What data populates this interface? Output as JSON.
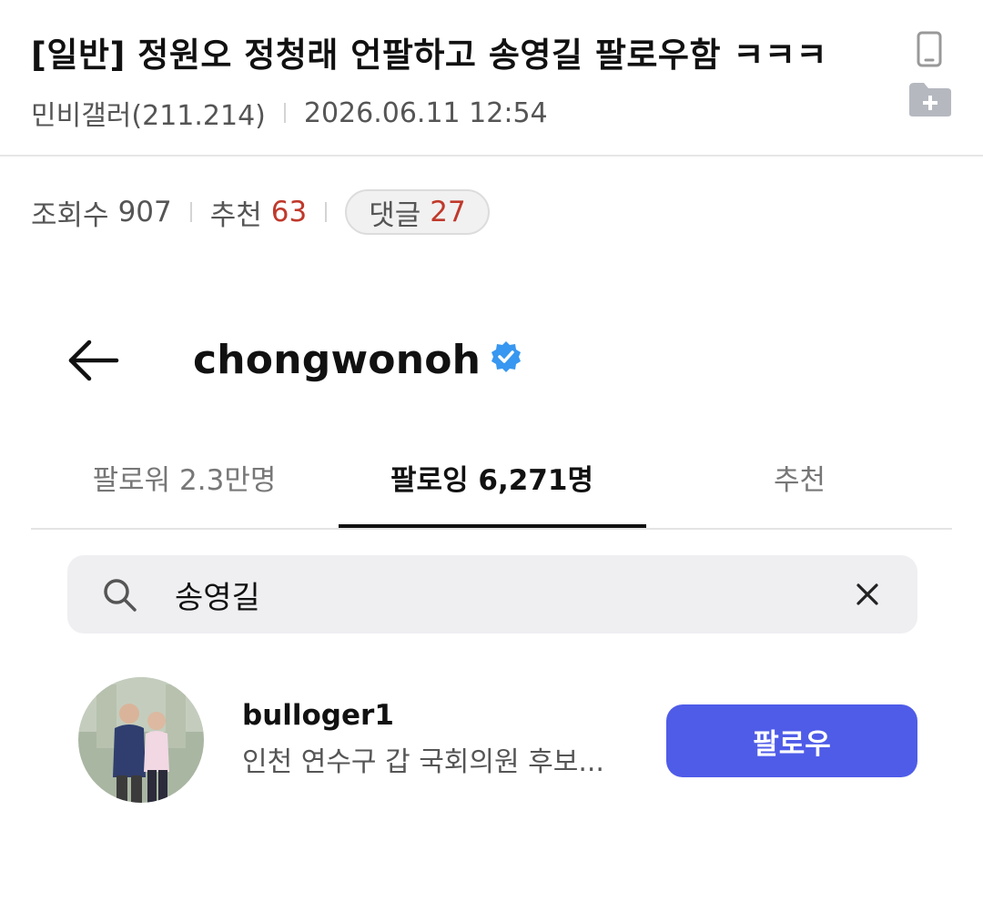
{
  "post": {
    "title": "[일반] 정원오 정청래 언팔하고 송영길 팔로우함 ㅋㅋㅋ",
    "author": "민비갤러(211.214)",
    "datetime": "2026.06.11 12:54",
    "stats": {
      "views_label": "조회수",
      "views": "907",
      "recommend_label": "추천",
      "recommend": "63",
      "comments_label": "댓글",
      "comments": "27"
    },
    "icons": {
      "device": "mobile-phone-icon",
      "folder": "folder-add-icon"
    }
  },
  "screenshot": {
    "username": "chongwonoh",
    "verified": true,
    "tabs": [
      {
        "label": "팔로워 2.3만명",
        "active": false
      },
      {
        "label": "팔로잉 6,271명",
        "active": true
      },
      {
        "label": "추천",
        "active": false
      }
    ],
    "search": {
      "value": "송영길"
    },
    "result": {
      "username": "bulloger1",
      "bio": "인천 연수구 갑 국회의원 후보...",
      "button": "팔로우"
    }
  },
  "colors": {
    "accent_red": "#c0392b",
    "follow_button": "#4f5ce8",
    "verified_blue": "#3897f0"
  }
}
